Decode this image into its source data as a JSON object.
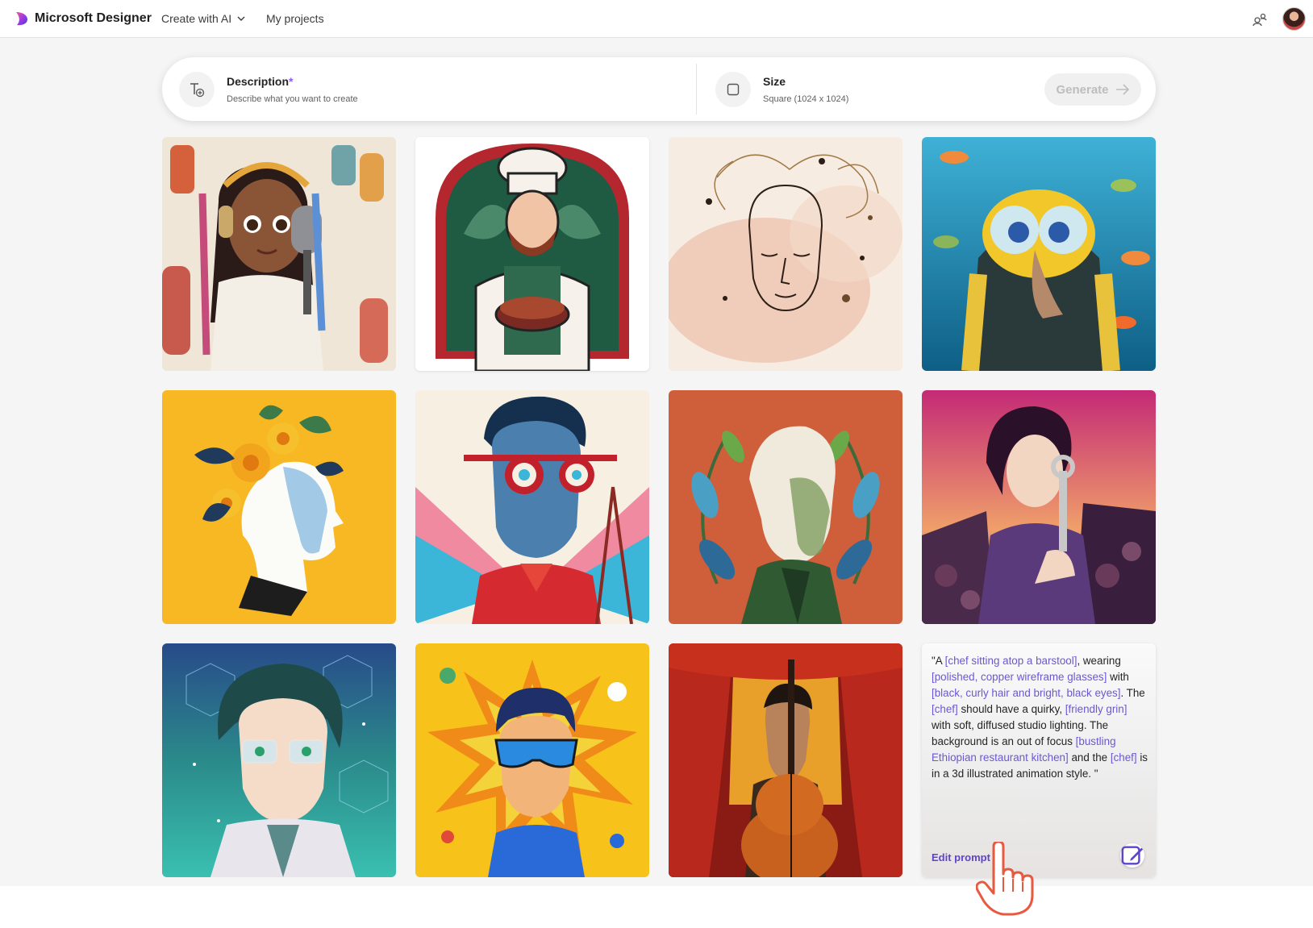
{
  "app": {
    "brand": "Microsoft Designer",
    "nav_create": "Create with AI",
    "nav_projects": "My projects"
  },
  "prompt_bar": {
    "description_label": "Description",
    "description_required": "*",
    "description_hint": "Describe what you want to create",
    "size_label": "Size",
    "size_value": "Square (1024 x 1024)",
    "generate_label": "Generate"
  },
  "gallery": {
    "images": [
      {
        "subject": "girl-with-headphones-and-microphone"
      },
      {
        "subject": "chef-holding-pie"
      },
      {
        "subject": "line-art-face-watercolor"
      },
      {
        "subject": "scuba-diver-clay-character"
      },
      {
        "subject": "paper-cut-flower-head-profile"
      },
      {
        "subject": "man-with-spiral-red-glasses"
      },
      {
        "subject": "old-man-leaves-portrait"
      },
      {
        "subject": "woman-with-wrench-scrapyard"
      },
      {
        "subject": "anime-man-with-glasses-space"
      },
      {
        "subject": "boy-with-sunglasses-comic-burst"
      },
      {
        "subject": "cellist-theater-curtain"
      }
    ],
    "prompt_card": {
      "segments": [
        {
          "t": "\"A ",
          "h": false
        },
        {
          "t": "[chef sitting atop a barstool]",
          "h": true
        },
        {
          "t": ", wearing ",
          "h": false
        },
        {
          "t": "[polished, copper wireframe glasses]",
          "h": true
        },
        {
          "t": " with ",
          "h": false
        },
        {
          "t": "[black, curly hair and bright, black eyes]",
          "h": true
        },
        {
          "t": ". The ",
          "h": false
        },
        {
          "t": "[chef]",
          "h": true
        },
        {
          "t": " should have a quirky, ",
          "h": false
        },
        {
          "t": "[friendly grin]",
          "h": true
        },
        {
          "t": " with soft, diffused studio lighting. The background is an out of focus ",
          "h": false
        },
        {
          "t": "[bustling Ethiopian restaurant kitchen]",
          "h": true
        },
        {
          "t": " and the ",
          "h": false
        },
        {
          "t": "[chef]",
          "h": true
        },
        {
          "t": " is in a 3d illustrated animation style. \"",
          "h": false
        }
      ],
      "edit_label": "Edit prompt"
    }
  }
}
